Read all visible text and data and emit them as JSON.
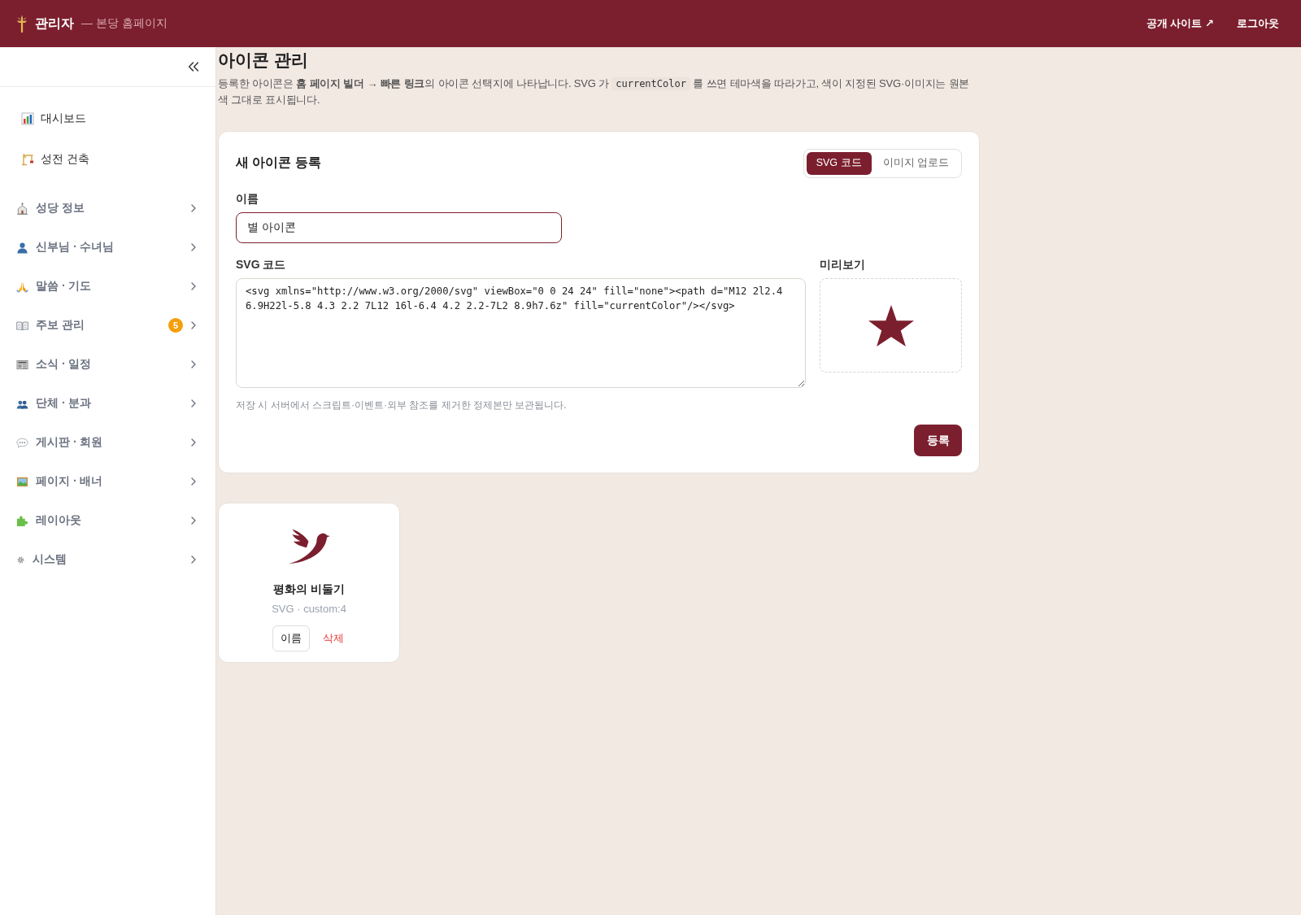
{
  "header": {
    "title": "관리자",
    "subtitle": "— 본당 홈페이지",
    "links": [
      "공개 사이트 ↗",
      "로그아웃"
    ]
  },
  "sidebar": {
    "links": [
      {
        "label": "대시보드"
      },
      {
        "label": "성전 건축"
      }
    ],
    "groups": [
      {
        "label": "성당 정보",
        "expanded": false
      },
      {
        "label": "신부님 · 수녀님",
        "expanded": false
      },
      {
        "label": "말씀 · 기도",
        "expanded": false
      },
      {
        "label": "주보 관리",
        "badge": "5",
        "expanded": false
      },
      {
        "label": "소식 · 일정",
        "expanded": false
      },
      {
        "label": "단체 · 분과",
        "expanded": false
      },
      {
        "label": "게시판 · 회원",
        "expanded": false
      },
      {
        "label": "페이지 · 배너",
        "expanded": false
      },
      {
        "label": "레이아웃",
        "expanded": false
      },
      {
        "label": "시스템",
        "expanded": false
      }
    ]
  },
  "page": {
    "title": "아이콘 관리",
    "description": {
      "before": "등록한 아이콘은 **홈 페이지 빌더 → 빠른 링크**의 아이콘 선택지에 나타납니다. SVG 가",
      "code": "currentColor",
      "after": "를 쓰면 테마색을 따라가고, 색이 지정된 SVG·이미지는 원본 색 그대로 표시됩니다."
    }
  },
  "form": {
    "title": "새 아이콘 등록",
    "modes": [
      {
        "label": "SVG 코드",
        "selected": true
      },
      {
        "label": "이미지 업로드",
        "selected": false
      }
    ],
    "name_field": {
      "label": "이름",
      "value": "별 아이콘",
      "focused": true
    },
    "code_field": {
      "label": "SVG 코드",
      "value": "<svg xmlns=\"http://www.w3.org/2000/svg\" viewBox=\"0 0 24 24\" fill=\"none\"><path d=\"M12 2l2.4 6.9H22l-5.8 4.3 2.2 7L12 16l-6.4 4.2 2.2-7L2 8.9h7.6z\" fill=\"currentColor\"/></svg>",
      "focused": false
    },
    "preview": {
      "label": "미리보기"
    },
    "hint": "저장 시 서버에서 스크립트·이벤트·외부 참조를 제거한 정제본만 보관됩니다.",
    "submit": "등록"
  },
  "icons": [
    {
      "name": "평화의 비둘기",
      "meta": "SVG · custom:4",
      "actions": [
        {
          "label": "이름",
          "kind": "outline"
        },
        {
          "label": "삭제",
          "kind": "danger"
        }
      ]
    }
  ]
}
